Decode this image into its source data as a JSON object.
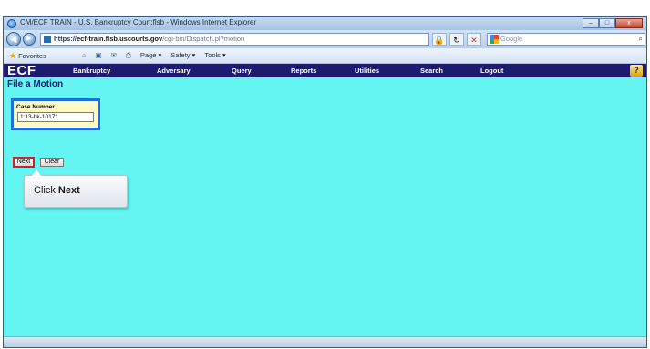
{
  "window": {
    "title": "CM/ECF TRAIN - U.S. Bankruptcy Court:flsb - Windows Internet Explorer",
    "controls": {
      "minimize": "–",
      "maximize": "□",
      "close": "x"
    }
  },
  "addressbar": {
    "back_glyph": "◀",
    "forward_glyph": "▶",
    "url_protocol": "https://",
    "url_domain": "ecf-train.flsb.uscourts.gov",
    "url_path": "/cgi-bin/Dispatch.pl?motion",
    "lock_glyph": "🔒",
    "refresh_glyph": "↻",
    "stop_glyph": "✕",
    "search_placeholder": "Google",
    "search_glyph": "⌕"
  },
  "commandbar": {
    "favorites_label": "Favorites",
    "items": [
      "Page ▾",
      "Safety ▾",
      "Tools ▾"
    ],
    "home_glyph": "⌂",
    "print_glyph": "⎙",
    "feeds_glyph": "▣",
    "mail_glyph": "✉"
  },
  "ecf": {
    "logo": "ECF",
    "menu": [
      "Bankruptcy",
      "Adversary",
      "Query",
      "Reports",
      "Utilities",
      "Search",
      "Logout"
    ],
    "help_glyph": "?"
  },
  "form": {
    "page_title": "File a Motion",
    "case_number_label": "Case Number",
    "case_number_value": "1:13-bk-10171",
    "next_label": "Next",
    "clear_label": "Clear"
  },
  "callout": {
    "prefix": "Click ",
    "emphasis": "Next"
  },
  "colors": {
    "content_bg": "#64f5f2",
    "menubar_bg": "#1c1b6e",
    "highlight_blue": "#1e6fd9",
    "highlight_red": "#d0202a",
    "case_panel_bg": "#fff9c4"
  }
}
